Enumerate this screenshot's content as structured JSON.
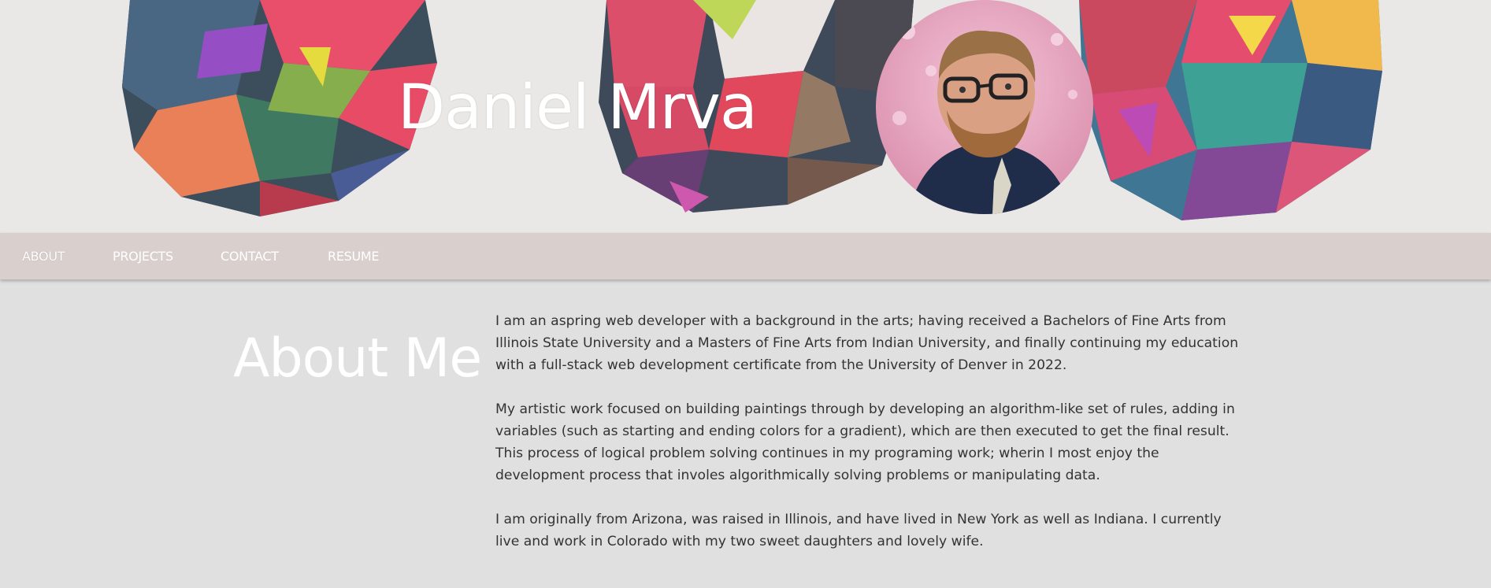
{
  "header": {
    "name": "Daniel Mrva"
  },
  "nav": {
    "items": [
      {
        "label": "ABOUT",
        "active": true
      },
      {
        "label": "PROJECTS",
        "active": false
      },
      {
        "label": "CONTACT",
        "active": false
      },
      {
        "label": "RESUME",
        "active": false
      }
    ]
  },
  "about": {
    "heading": "About Me",
    "paragraphs": [
      "I am an aspring web developer with a background in the arts; having received a Bachelors of Fine Arts from Illinois State University and a Masters of Fine Arts from Indian University, and finally continuing my education with a full-stack web development certificate from the University of Denver in 2022.",
      "My artistic work focused on building paintings through by developing an algorithm-like set of rules, adding in variables (such as starting and ending colors for a gradient), which are then executed to get the final result.",
      "This process of logical problem solving continues in my programing work; wherin I most enjoy the development process that involes algorithmically solving problems or manipulating data.",
      "I am originally from Arizona, was raised in Illinois, and have lived in New York as well as Indiana. I currently live and work in Colorado with my two sweet daughters and lovely wife."
    ]
  },
  "colors": {
    "nav_bg": "#d9cfcc",
    "page_bg": "#e0e0e0",
    "body_text": "#333333"
  }
}
